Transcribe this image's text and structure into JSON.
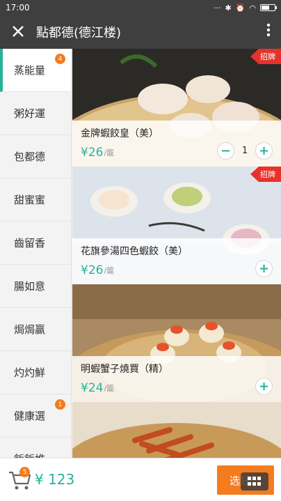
{
  "status": {
    "time": "17:00"
  },
  "header": {
    "title": "點都德(德江楼)"
  },
  "sidebar": {
    "items": [
      {
        "label": "蒸能量",
        "badge": "4",
        "active": true
      },
      {
        "label": "粥好運",
        "badge": ""
      },
      {
        "label": "包都德",
        "badge": ""
      },
      {
        "label": "甜蜜蜜",
        "badge": ""
      },
      {
        "label": "齒留香",
        "badge": ""
      },
      {
        "label": "腸如意",
        "badge": ""
      },
      {
        "label": "焗焗贏",
        "badge": ""
      },
      {
        "label": "灼灼鮮",
        "badge": ""
      },
      {
        "label": "健康選",
        "badge": "1"
      },
      {
        "label": "飯飯堆",
        "badge": ""
      }
    ]
  },
  "menu": {
    "items": [
      {
        "name": "金牌蝦餃皇（美）",
        "price": "¥26",
        "unit": "/籠",
        "tag": "招牌",
        "qty": "1"
      },
      {
        "name": "花旗參湯四色蝦餃（美）",
        "price": "¥26",
        "unit": "/籠",
        "tag": "招牌",
        "qty": ""
      },
      {
        "name": "明蝦蟹子燒買（精）",
        "price": "¥24",
        "unit": "/籠",
        "tag": "",
        "qty": ""
      }
    ]
  },
  "cart": {
    "count": "5",
    "total": "¥ 123",
    "choose_label": "选好"
  },
  "icons": {
    "close": "close-icon",
    "more": "more-vert-icon",
    "cart": "cart-icon",
    "grid": "grid-icon"
  },
  "colors": {
    "accent": "#26b39a",
    "orange": "#f57b1f",
    "tag_red": "#e6322a",
    "bar": "#3f3f3f"
  }
}
